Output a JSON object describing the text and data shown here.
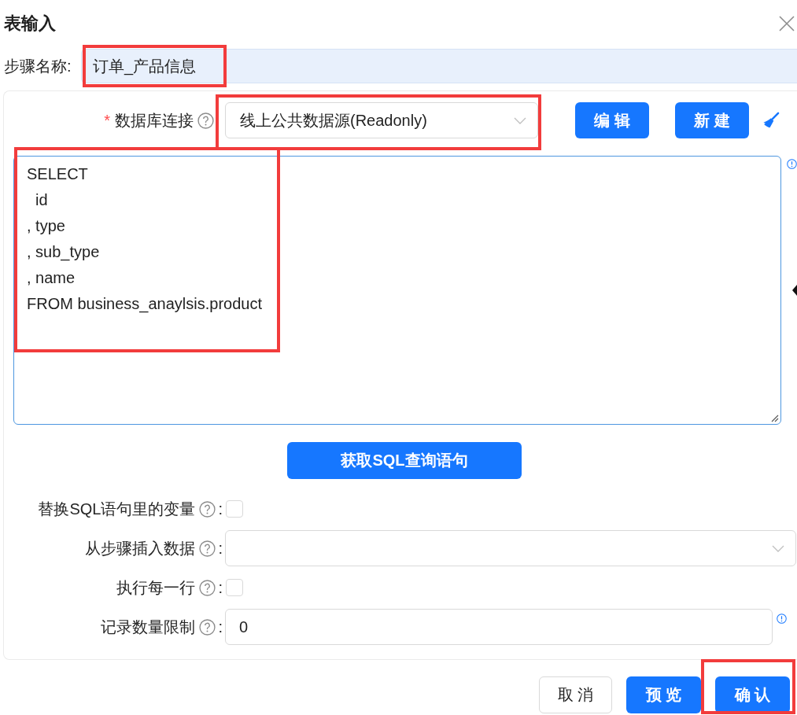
{
  "dialog": {
    "title": "表输入"
  },
  "step_name": {
    "label": "步骤名称:",
    "value": "订单_产品信息",
    "highlighted": true
  },
  "connection": {
    "required_mark": "*",
    "label": "数据库连接",
    "value": "线上公共数据源(Readonly)",
    "highlighted": true
  },
  "connection_buttons": [
    "编 辑",
    "新 建"
  ],
  "sql": {
    "value": "SELECT\n  id\n, type\n, sub_type\n, name\nFROM business_anaylsis.product",
    "highlighted": true
  },
  "get_sql_button": {
    "label": "获取SQL查询语句"
  },
  "options": [
    {
      "kind": "checkbox",
      "label": "替换SQL语句里的变量",
      "suffix": ":",
      "checked": false
    },
    {
      "kind": "select",
      "label": "从步骤插入数据",
      "suffix": ":"
    },
    {
      "kind": "checkbox",
      "label": "执行每一行",
      "suffix": ":",
      "checked": false
    },
    {
      "kind": "input",
      "label": "记录数量限制",
      "suffix": ":",
      "value": "0"
    }
  ],
  "footer_buttons": [
    {
      "label": "取 消",
      "kind": "secondary",
      "highlighted": false
    },
    {
      "label": "预 览",
      "kind": "primary",
      "highlighted": false
    },
    {
      "label": "确 认",
      "kind": "primary",
      "highlighted": true
    }
  ]
}
